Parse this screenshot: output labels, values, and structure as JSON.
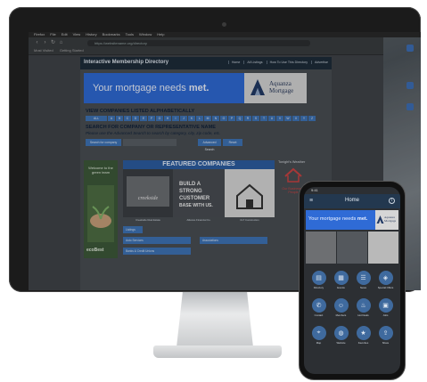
{
  "desktop": {
    "menubar": [
      "Firefox",
      "File",
      "Edit",
      "View",
      "History",
      "Bookmarks",
      "Tools",
      "Window",
      "Help"
    ],
    "browser": {
      "url": "https://websitename.org/directory",
      "bookmarks": [
        "Most Visited",
        "Getting Started"
      ]
    },
    "site": {
      "title": "Interactive Membership Directory",
      "nav": [
        "Home",
        "All Listings",
        "How To Use This Directory",
        "Advertise"
      ],
      "ad": {
        "text_plain": "Your mortgage needs ",
        "text_bold": "met.",
        "brand_line1": "Aquanza",
        "brand_line2": "Mortgage",
        "color": "#2f6bd6"
      },
      "alpha_heading": "VIEW COMPANIES LISTED ALPHABETICALLY",
      "alpha_all": "ALL",
      "letters": [
        "A",
        "B",
        "C",
        "D",
        "E",
        "F",
        "G",
        "H",
        "I",
        "J",
        "K",
        "L",
        "M",
        "N",
        "O",
        "P",
        "Q",
        "R",
        "S",
        "T",
        "U",
        "V",
        "W",
        "X",
        "Y",
        "Z"
      ],
      "search_heading": "SEARCH FOR COMPANY OR REPRESENTATIVE NAME",
      "search_sub": "Please use the Advanced Search to search by category, city, zip code, etc.",
      "search_button": "Search for company",
      "search_placeholder": "",
      "advanced_button": "Advanced Search",
      "reset_button": "Reset",
      "featured_heading": "FEATURED COMPANIES",
      "featured": [
        {
          "caption": "Creekside Real Estate"
        },
        {
          "caption": "Alliance Financial Co."
        },
        {
          "caption": "CLT Construction"
        }
      ],
      "side_ad_text": "Welcome to the green team",
      "side_ad_brand": "ecoBest",
      "right_col_title": "Tonight's Weather",
      "right_col_text": "Our Business is People",
      "list_items": [
        "Listings",
        "Auto Services",
        "Associations",
        "Banks & Credit Unions"
      ]
    }
  },
  "phone": {
    "status_time": "9:41",
    "title": "Home",
    "ad_text_plain": "Your mortgage needs ",
    "ad_text_bold": "met.",
    "ad_brand_line1": "Aquanza",
    "ad_brand_line2": "Mortgage",
    "tiles": [
      {
        "label": "Directory",
        "icon": "book-icon"
      },
      {
        "label": "Events",
        "icon": "calendar-icon"
      },
      {
        "label": "News",
        "icon": "news-icon"
      },
      {
        "label": "Special Offers",
        "icon": "tag-icon"
      },
      {
        "label": "Contact",
        "icon": "phone-icon"
      },
      {
        "label": "Members",
        "icon": "people-icon"
      },
      {
        "label": "Hot Deals",
        "icon": "fire-icon"
      },
      {
        "label": "Jobs",
        "icon": "briefcase-icon"
      },
      {
        "label": "Map",
        "icon": "map-icon"
      },
      {
        "label": "Website",
        "icon": "globe-icon"
      },
      {
        "label": "Favorites",
        "icon": "star-icon"
      },
      {
        "label": "Share",
        "icon": "share-icon"
      }
    ]
  },
  "colors": {
    "header": "#1e2c3a",
    "accent": "#3f74b8",
    "featured": "#2c5da1"
  }
}
